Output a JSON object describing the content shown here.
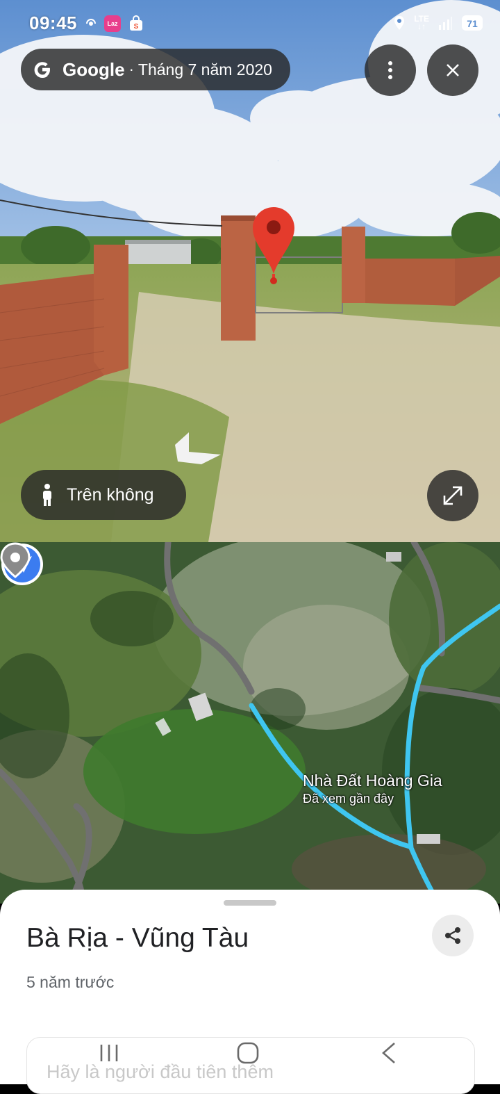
{
  "status_bar": {
    "time": "09:45",
    "lte_top": "LTE",
    "lte_bottom": "↓↑",
    "app_icon_1": "Laz",
    "icons": [
      "signal-icon",
      "laz-app-icon",
      "shopping-bag-icon",
      "location-icon",
      "lte-icon",
      "cell-signal-icon",
      "battery-icon"
    ]
  },
  "streetview": {
    "brand": "Google",
    "separator": "·",
    "date": "Tháng 7 năm 2020",
    "aerial_button_label": "Trên không",
    "icons": [
      "google-g-icon",
      "more-vert-icon",
      "close-icon",
      "person-icon",
      "expand-icon",
      "location-pin-icon",
      "move-arrow-icon"
    ]
  },
  "map": {
    "place_name": "Nhà Đất Hoàng Gia",
    "place_subtitle": "Đã xem gần đây",
    "route_color": "#3fc6f0",
    "navigation_color": "#3b7cf0"
  },
  "sheet": {
    "title": "Bà Rịa - Vũng Tàu",
    "subtitle": "5 năm trước",
    "prompt_text": "Hãy là người đầu tiên thêm"
  },
  "colors": {
    "pin_red": "#e43b2c",
    "overlay": "#282828"
  }
}
